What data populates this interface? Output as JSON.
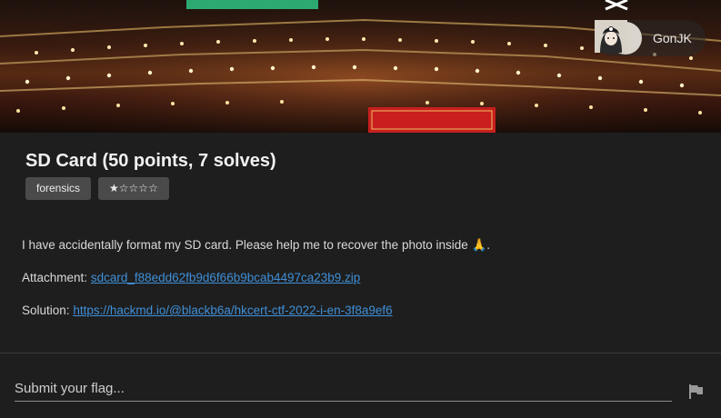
{
  "header": {
    "user": {
      "name": "GonJK",
      "avatar_icon": "avatar-icon"
    }
  },
  "challenge": {
    "title": "SD Card (50 points, 7 solves)",
    "tags": [
      {
        "label": "forensics"
      },
      {
        "label": "★☆☆☆☆"
      }
    ],
    "difficulty_stars": 1,
    "description": "I have accidentally format my SD card. Please help me to recover the photo inside 🙏.",
    "attachment": {
      "label": "Attachment:",
      "link_text": "sdcard_f88edd62fb9d6f66b9bcab4497ca23b9.zip"
    },
    "solution": {
      "label": "Solution:",
      "link_text": "https://hackmd.io/@blackb6a/hkcert-ctf-2022-i-en-3f8a9ef6"
    }
  },
  "submit": {
    "placeholder": "Submit your flag...",
    "button_icon": "flag-icon"
  },
  "colors": {
    "background": "#1e1e1e",
    "link": "#3f8fd8",
    "tag_bg": "#4a4a4a"
  }
}
